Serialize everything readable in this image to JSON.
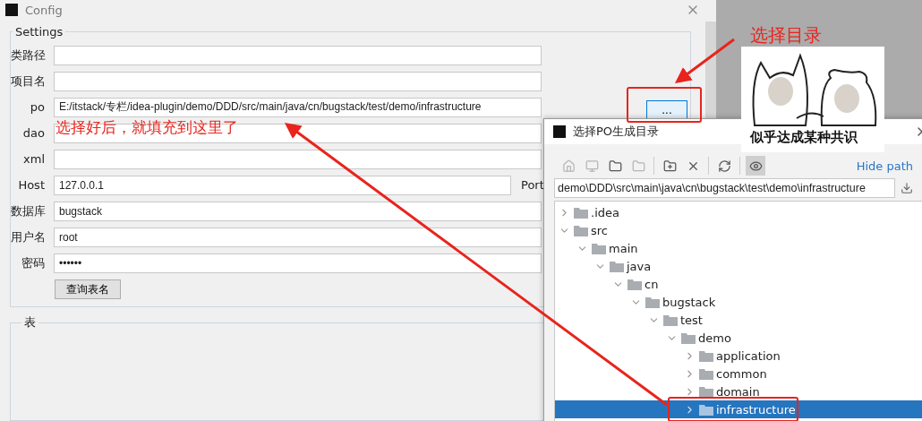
{
  "config_window": {
    "title": "Config",
    "settings": {
      "legend": "Settings",
      "fields": [
        {
          "label": "类路径"
        },
        {
          "label": "项目名"
        },
        {
          "label": "po",
          "value": "E:/itstack/专栏/idea-plugin/demo/DDD/src/main/java/cn/bugstack/test/demo/infrastructure"
        },
        {
          "label": "dao"
        },
        {
          "label": "xml"
        },
        {
          "label": "Host",
          "value": "127.0.0.1",
          "side_label": "Port"
        },
        {
          "label": "数据库",
          "value": "bugstack"
        },
        {
          "label": "用户名",
          "value": "root"
        },
        {
          "label": "密码",
          "value": "••••••"
        }
      ],
      "query_button": "查询表名",
      "browse_button": "..."
    },
    "table_group": {
      "legend": "表"
    }
  },
  "dir_dialog": {
    "title": "选择PO生成目录",
    "toolbar": [
      {
        "kind": "home",
        "disabled": true,
        "pressed": false
      },
      {
        "kind": "desktop",
        "disabled": true,
        "pressed": false
      },
      {
        "kind": "folder",
        "disabled": false,
        "pressed": false
      },
      {
        "kind": "folder",
        "disabled": true,
        "pressed": false
      },
      {
        "kind": "new-folder",
        "disabled": false,
        "pressed": false
      },
      {
        "kind": "delete",
        "disabled": false,
        "pressed": false
      },
      {
        "kind": "refresh",
        "disabled": false,
        "pressed": false
      },
      {
        "kind": "hidden",
        "disabled": false,
        "pressed": true
      }
    ],
    "hide_path_link": "Hide path",
    "path": "demo\\DDD\\src\\main\\java\\cn\\bugstack\\test\\demo\\infrastructure",
    "tree": [
      {
        "label": ".idea",
        "expanded": false,
        "selected": false
      },
      {
        "label": "src",
        "expanded": true,
        "selected": false,
        "children": [
          {
            "label": "main",
            "expanded": true,
            "selected": false,
            "children": [
              {
                "label": "java",
                "expanded": true,
                "selected": false,
                "children": [
                  {
                    "label": "cn",
                    "expanded": true,
                    "selected": false,
                    "children": [
                      {
                        "label": "bugstack",
                        "expanded": true,
                        "selected": false,
                        "children": [
                          {
                            "label": "test",
                            "expanded": true,
                            "selected": false,
                            "children": [
                              {
                                "label": "demo",
                                "expanded": true,
                                "selected": false,
                                "children": [
                                  {
                                    "label": "application",
                                    "expanded": false,
                                    "selected": false
                                  },
                                  {
                                    "label": "common",
                                    "expanded": false,
                                    "selected": false
                                  },
                                  {
                                    "label": "domain",
                                    "expanded": false,
                                    "selected": false
                                  },
                                  {
                                    "label": "infrastructure",
                                    "expanded": false,
                                    "selected": true
                                  }
                                ]
                              }
                            ]
                          }
                        ]
                      }
                    ]
                  }
                ]
              }
            ]
          }
        ]
      }
    ]
  },
  "annotations": {
    "select_dir_note": "选择目录",
    "fill_note": "选择好后，就填充到这里了",
    "meme_caption": "似乎达成某种共识"
  }
}
